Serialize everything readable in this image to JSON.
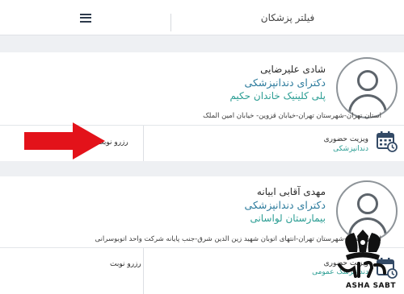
{
  "header": {
    "filter_label": "فیلتر پزشکان",
    "list_icon": "list-icon"
  },
  "doctors": [
    {
      "name": "شادی علیرضایی",
      "specialty": "دکترای دندانپزشکی",
      "clinic": "پلی کلینیک خاندان حکیم",
      "address": "استان تهران-شهرستان تهران-خیابان قزوین- خیابان امین الملک",
      "visit_type": "ویزیت حضوری",
      "visit_specialty": "دندانپزشکی",
      "book_label": "رزرو نوبت"
    },
    {
      "name": "مهدی آقابی ابیانه",
      "specialty": "دکترای دندانپزشکی",
      "clinic": "بیمارستان لواسانی",
      "address": "استان تهران-شهرستان تهران-انتهای اتوبان شهید زین الدین شرق-جنب پایانه شرکت واحد اتوبوسرانی",
      "visit_type": "ویزیت حضوری",
      "visit_specialty": "دندانپزشک عمومی",
      "book_label": "رزرو نوبت"
    }
  ],
  "watermark": {
    "brand_fa": "ثبت آشنا",
    "brand_en": "ASHA SABT"
  },
  "colors": {
    "accent_blue": "#2b7a9c",
    "accent_teal": "#2a9d93",
    "arrow_red": "#e3121a",
    "calendar_icon": "#334a66"
  }
}
